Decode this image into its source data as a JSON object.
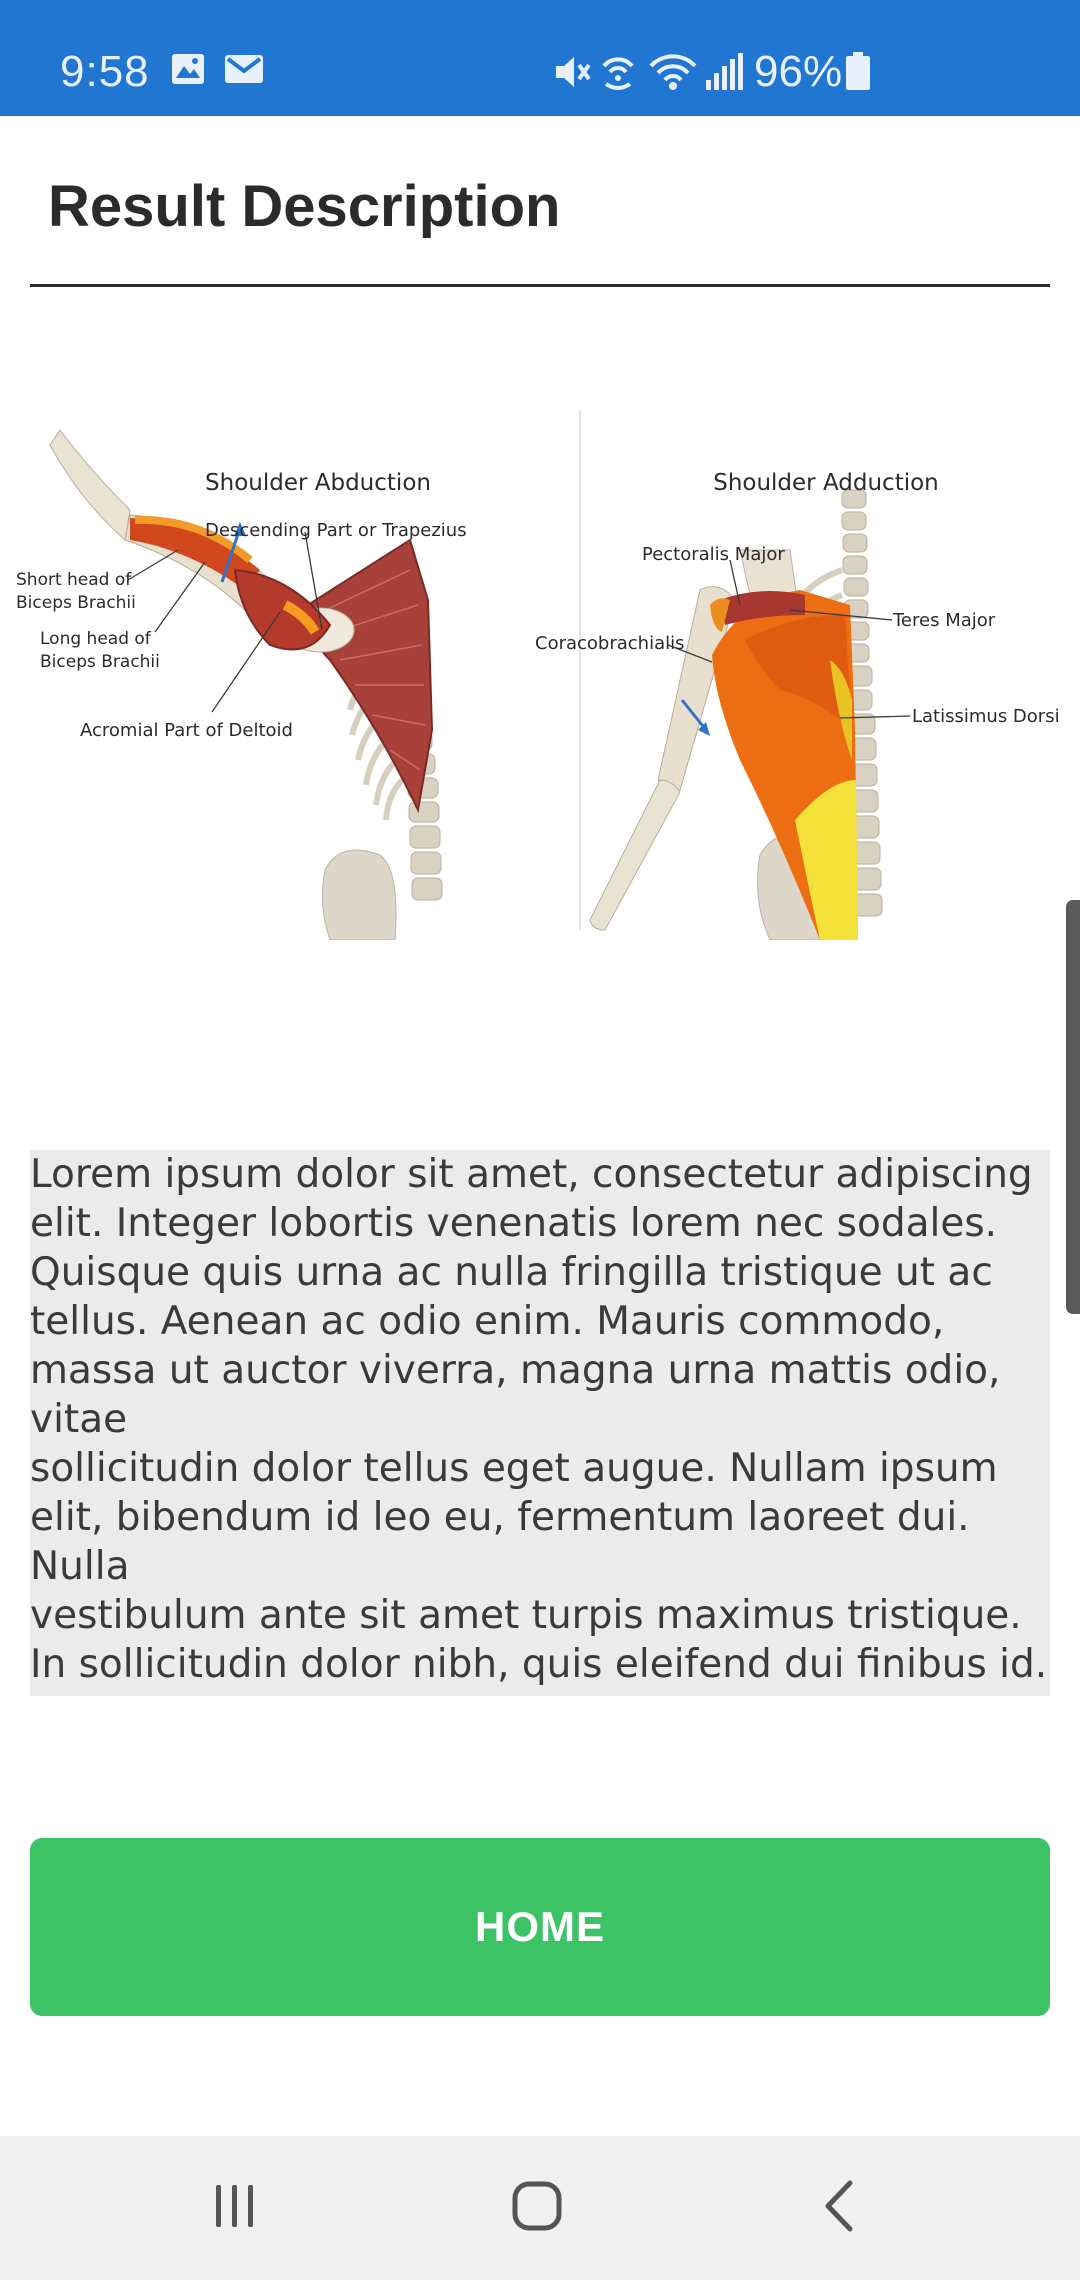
{
  "status_bar": {
    "time": "9:58",
    "battery": "96%",
    "icons": [
      "gallery-icon",
      "email-icon",
      "mute-icon",
      "wifi-calling-icon",
      "wifi-icon",
      "signal-icon",
      "battery-icon"
    ],
    "background": "#2176d2"
  },
  "header": {
    "title": "Result Description"
  },
  "figure": {
    "left_panel": {
      "title": "Shoulder Abduction",
      "labels": [
        "Descending Part or Trapezius",
        "Short head of\nBiceps Brachii",
        "Long head of\nBiceps Brachii",
        "Acromial Part of Deltoid"
      ]
    },
    "right_panel": {
      "title": "Shoulder Adduction",
      "labels": [
        "Pectoralis Major",
        "Teres Major",
        "Coracobrachialis",
        "Latissimus Dorsi"
      ]
    }
  },
  "description": {
    "text": "Lorem ipsum dolor sit amet, consectetur adipiscing\nelit. Integer lobortis venenatis lorem nec sodales.\nQuisque quis urna ac nulla fringilla tristique ut ac\ntellus. Aenean ac odio enim. Mauris commodo,\nmassa ut auctor viverra, magna urna mattis odio, vitae\nsollicitudin dolor tellus eget augue. Nullam ipsum\nelit, bibendum id leo eu, fermentum laoreet dui. Nulla\nvestibulum ante sit amet turpis maximus tristique.\nIn sollicitudin dolor nibh, quis eleifend dui finibus id.\nAliquam ut suscipit libero. Praesent tellus massa,\ntincidunt ac augue vitae, suscipit venenatis libero."
  },
  "home_button": {
    "label": "HOME",
    "color": "#3cc366"
  },
  "nav_bar": {
    "icons": [
      "recent-apps-icon",
      "home-icon",
      "back-icon"
    ]
  }
}
